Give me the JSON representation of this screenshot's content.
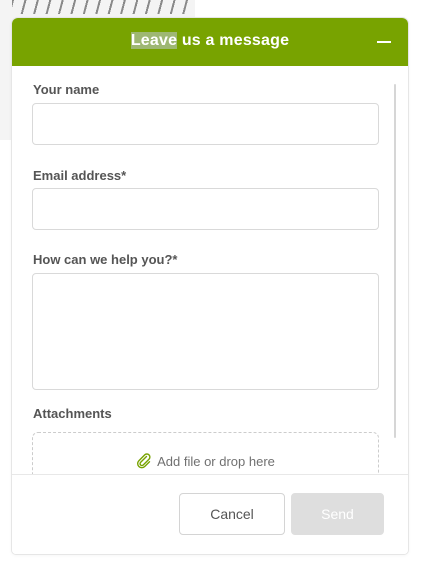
{
  "header": {
    "title_highlighted": "Leave",
    "title_rest": " us a message",
    "minimize_icon": "minus-icon",
    "background_color": "#78a300"
  },
  "form": {
    "name": {
      "label": "Your name",
      "value": "",
      "placeholder": ""
    },
    "email": {
      "label": "Email address*",
      "value": "",
      "placeholder": ""
    },
    "message": {
      "label": "How can we help you?*",
      "value": "",
      "placeholder": ""
    },
    "attachments": {
      "label": "Attachments",
      "drop_text": "Add file or drop here",
      "icon": "paperclip-icon"
    }
  },
  "footer": {
    "cancel_label": "Cancel",
    "send_label": "Send"
  }
}
